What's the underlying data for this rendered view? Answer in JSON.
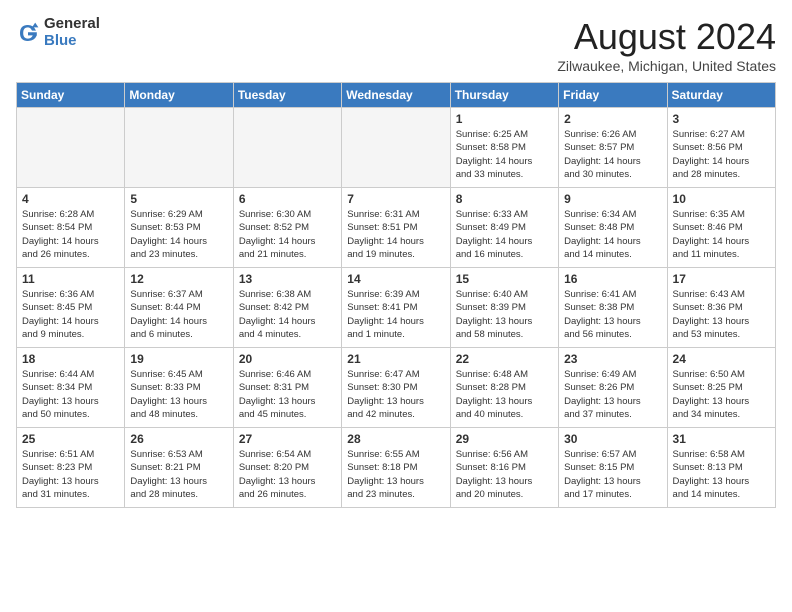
{
  "logo": {
    "general": "General",
    "blue": "Blue"
  },
  "title": "August 2024",
  "location": "Zilwaukee, Michigan, United States",
  "headers": [
    "Sunday",
    "Monday",
    "Tuesday",
    "Wednesday",
    "Thursday",
    "Friday",
    "Saturday"
  ],
  "weeks": [
    [
      {
        "day": "",
        "info": ""
      },
      {
        "day": "",
        "info": ""
      },
      {
        "day": "",
        "info": ""
      },
      {
        "day": "",
        "info": ""
      },
      {
        "day": "1",
        "info": "Sunrise: 6:25 AM\nSunset: 8:58 PM\nDaylight: 14 hours\nand 33 minutes."
      },
      {
        "day": "2",
        "info": "Sunrise: 6:26 AM\nSunset: 8:57 PM\nDaylight: 14 hours\nand 30 minutes."
      },
      {
        "day": "3",
        "info": "Sunrise: 6:27 AM\nSunset: 8:56 PM\nDaylight: 14 hours\nand 28 minutes."
      }
    ],
    [
      {
        "day": "4",
        "info": "Sunrise: 6:28 AM\nSunset: 8:54 PM\nDaylight: 14 hours\nand 26 minutes."
      },
      {
        "day": "5",
        "info": "Sunrise: 6:29 AM\nSunset: 8:53 PM\nDaylight: 14 hours\nand 23 minutes."
      },
      {
        "day": "6",
        "info": "Sunrise: 6:30 AM\nSunset: 8:52 PM\nDaylight: 14 hours\nand 21 minutes."
      },
      {
        "day": "7",
        "info": "Sunrise: 6:31 AM\nSunset: 8:51 PM\nDaylight: 14 hours\nand 19 minutes."
      },
      {
        "day": "8",
        "info": "Sunrise: 6:33 AM\nSunset: 8:49 PM\nDaylight: 14 hours\nand 16 minutes."
      },
      {
        "day": "9",
        "info": "Sunrise: 6:34 AM\nSunset: 8:48 PM\nDaylight: 14 hours\nand 14 minutes."
      },
      {
        "day": "10",
        "info": "Sunrise: 6:35 AM\nSunset: 8:46 PM\nDaylight: 14 hours\nand 11 minutes."
      }
    ],
    [
      {
        "day": "11",
        "info": "Sunrise: 6:36 AM\nSunset: 8:45 PM\nDaylight: 14 hours\nand 9 minutes."
      },
      {
        "day": "12",
        "info": "Sunrise: 6:37 AM\nSunset: 8:44 PM\nDaylight: 14 hours\nand 6 minutes."
      },
      {
        "day": "13",
        "info": "Sunrise: 6:38 AM\nSunset: 8:42 PM\nDaylight: 14 hours\nand 4 minutes."
      },
      {
        "day": "14",
        "info": "Sunrise: 6:39 AM\nSunset: 8:41 PM\nDaylight: 14 hours\nand 1 minute."
      },
      {
        "day": "15",
        "info": "Sunrise: 6:40 AM\nSunset: 8:39 PM\nDaylight: 13 hours\nand 58 minutes."
      },
      {
        "day": "16",
        "info": "Sunrise: 6:41 AM\nSunset: 8:38 PM\nDaylight: 13 hours\nand 56 minutes."
      },
      {
        "day": "17",
        "info": "Sunrise: 6:43 AM\nSunset: 8:36 PM\nDaylight: 13 hours\nand 53 minutes."
      }
    ],
    [
      {
        "day": "18",
        "info": "Sunrise: 6:44 AM\nSunset: 8:34 PM\nDaylight: 13 hours\nand 50 minutes."
      },
      {
        "day": "19",
        "info": "Sunrise: 6:45 AM\nSunset: 8:33 PM\nDaylight: 13 hours\nand 48 minutes."
      },
      {
        "day": "20",
        "info": "Sunrise: 6:46 AM\nSunset: 8:31 PM\nDaylight: 13 hours\nand 45 minutes."
      },
      {
        "day": "21",
        "info": "Sunrise: 6:47 AM\nSunset: 8:30 PM\nDaylight: 13 hours\nand 42 minutes."
      },
      {
        "day": "22",
        "info": "Sunrise: 6:48 AM\nSunset: 8:28 PM\nDaylight: 13 hours\nand 40 minutes."
      },
      {
        "day": "23",
        "info": "Sunrise: 6:49 AM\nSunset: 8:26 PM\nDaylight: 13 hours\nand 37 minutes."
      },
      {
        "day": "24",
        "info": "Sunrise: 6:50 AM\nSunset: 8:25 PM\nDaylight: 13 hours\nand 34 minutes."
      }
    ],
    [
      {
        "day": "25",
        "info": "Sunrise: 6:51 AM\nSunset: 8:23 PM\nDaylight: 13 hours\nand 31 minutes."
      },
      {
        "day": "26",
        "info": "Sunrise: 6:53 AM\nSunset: 8:21 PM\nDaylight: 13 hours\nand 28 minutes."
      },
      {
        "day": "27",
        "info": "Sunrise: 6:54 AM\nSunset: 8:20 PM\nDaylight: 13 hours\nand 26 minutes."
      },
      {
        "day": "28",
        "info": "Sunrise: 6:55 AM\nSunset: 8:18 PM\nDaylight: 13 hours\nand 23 minutes."
      },
      {
        "day": "29",
        "info": "Sunrise: 6:56 AM\nSunset: 8:16 PM\nDaylight: 13 hours\nand 20 minutes."
      },
      {
        "day": "30",
        "info": "Sunrise: 6:57 AM\nSunset: 8:15 PM\nDaylight: 13 hours\nand 17 minutes."
      },
      {
        "day": "31",
        "info": "Sunrise: 6:58 AM\nSunset: 8:13 PM\nDaylight: 13 hours\nand 14 minutes."
      }
    ]
  ]
}
